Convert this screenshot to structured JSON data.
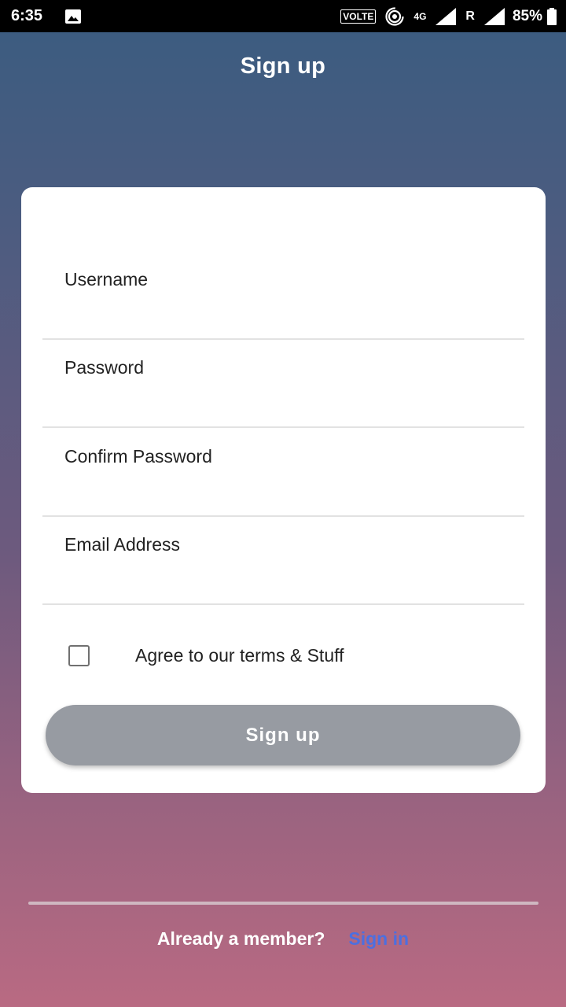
{
  "status_bar": {
    "time": "6:35",
    "volte": "VOLTE",
    "network": "4G",
    "roaming": "R",
    "battery": "85%"
  },
  "header": {
    "title": "Sign up"
  },
  "form": {
    "fields": [
      {
        "label": "Username"
      },
      {
        "label": "Password"
      },
      {
        "label": "Confirm Password"
      },
      {
        "label": "Email Address"
      }
    ],
    "checkbox_label": "Agree to our terms & Stuff",
    "submit_label": "Sign up"
  },
  "footer": {
    "question": "Already a member?",
    "link": "Sign in"
  },
  "colors": {
    "button": "#979ba2",
    "link": "#4c6fe0"
  }
}
